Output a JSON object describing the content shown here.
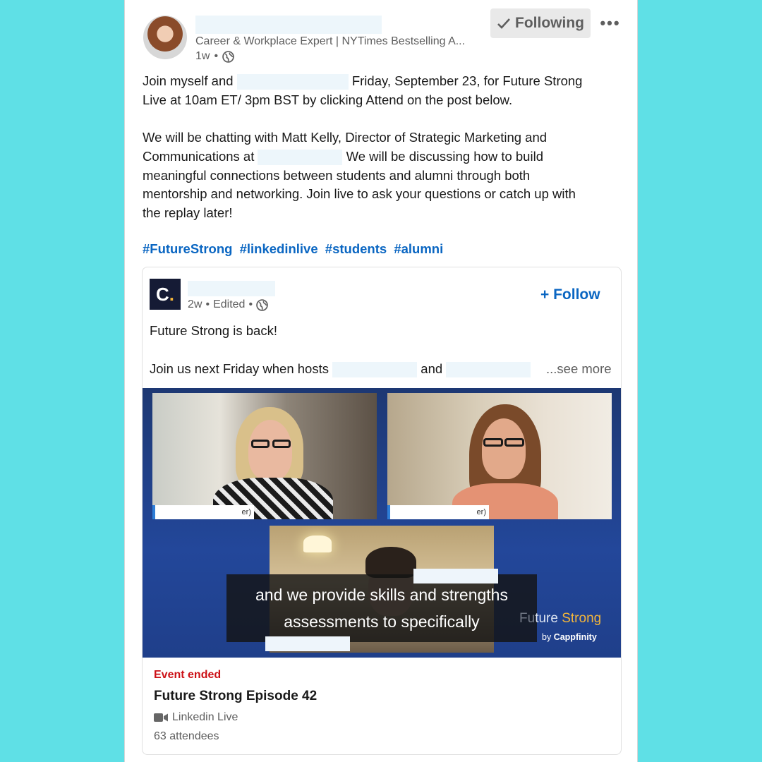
{
  "post": {
    "author_headline": "Career & Workplace Expert | NYTimes Bestselling A...",
    "time": "1w",
    "visibility_separator": "•",
    "following_label": "Following",
    "more_label": "•••",
    "body": {
      "line1_start": "Join myself and",
      "line1_end": "Friday, September 23, for Future Strong",
      "line2": "Live at 10am ET/ 3pm BST by clicking Attend on the post below.",
      "line3": "We will be chatting with Matt Kelly, Director of Strategic Marketing and",
      "line4_start": "Communications at",
      "line4_end": "We will be discussing how to build",
      "line5": "meaningful connections between students and alumni through both",
      "line6": "mentorship and networking. Join live to ask your questions or catch up with",
      "line7": "the replay later!"
    },
    "hashtags": [
      "#FutureStrong",
      "#linkedinlive",
      "#students",
      "#alumni"
    ]
  },
  "embed": {
    "logo_letter": "C",
    "logo_dot": ".",
    "time": "2w",
    "edited": "Edited",
    "separator": "•",
    "follow_label": "Follow",
    "text_line1": "Future Strong is back!",
    "text_line2_start": "Join us next Friday when hosts",
    "text_line2_mid": "and",
    "see_more": "...see more",
    "video": {
      "tag1_suffix": "er)",
      "tag2_suffix": "er)",
      "caption_line1": "and we provide skills and strengths",
      "caption_line2": "assessments to specifically",
      "brand_prefix": "Fu",
      "brand_mid": "ture ",
      "brand_accent": "Strong",
      "brand_by": "by ",
      "brand_company": "Cappfinity"
    },
    "event": {
      "status": "Event ended",
      "title": "Future Strong Episode 42",
      "type": "Linkedin Live",
      "attendees": "63 attendees"
    }
  },
  "colors": {
    "background": "#5fe0e6",
    "link_blue": "#0a66c2",
    "event_red": "#cc1016",
    "video_blue": "#23479a"
  }
}
